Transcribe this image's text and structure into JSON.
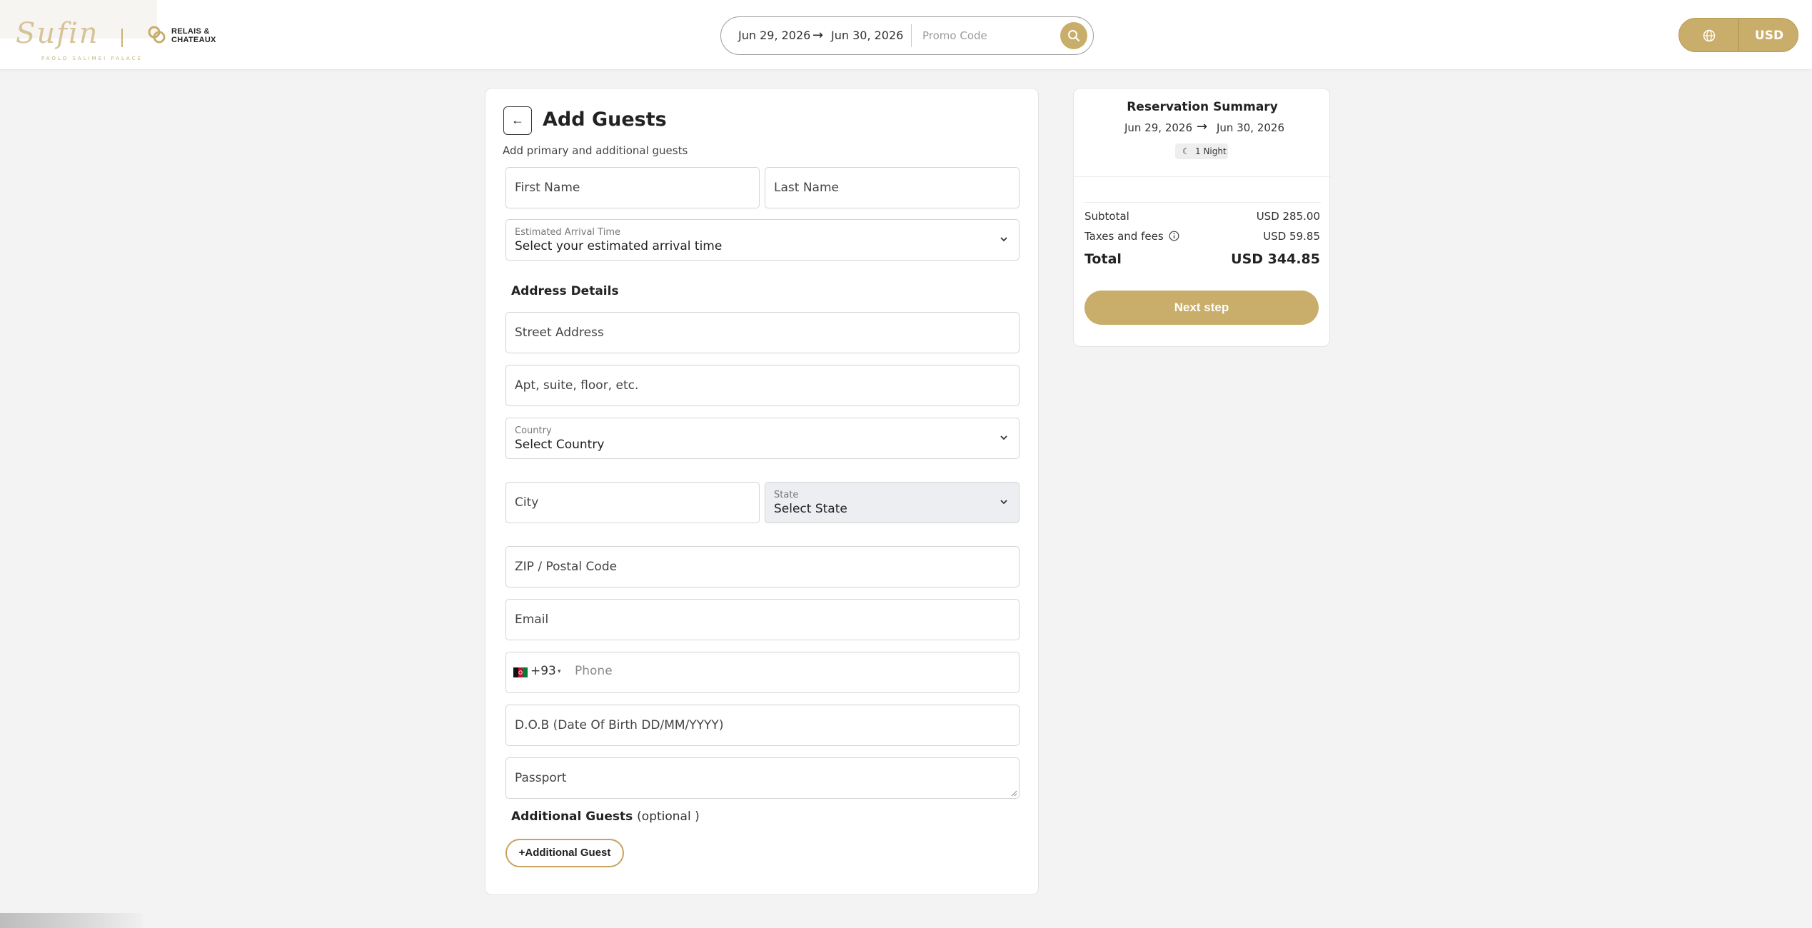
{
  "header": {
    "logo": {
      "script": "Sufin",
      "subtitle": "PAOLO SALIMEI PALACE",
      "partner": "RELAIS &\nCHATEAUX"
    },
    "search": {
      "checkin": "Jun 29, 2026",
      "arrow": "→",
      "checkout": "Jun 30, 2026",
      "promo_placeholder": "Promo Code"
    },
    "currency": "USD"
  },
  "form": {
    "back_label": "←",
    "title": "Add Guests",
    "subtitle": "Add primary and additional guests",
    "first_name": "First Name",
    "last_name": "Last Name",
    "arrival": {
      "label": "Estimated Arrival Time",
      "value": "Select your estimated arrival time"
    },
    "address_heading": "Address Details",
    "street": "Street Address",
    "apt": "Apt, suite, floor, etc.",
    "country": {
      "label": "Country",
      "value": "Select Country"
    },
    "city": "City",
    "state": {
      "label": "State",
      "value": "Select State"
    },
    "zip": "ZIP / Postal Code",
    "email": "Email",
    "phone": {
      "code": "+93",
      "caret": "▾",
      "placeholder": "Phone"
    },
    "dob": "D.O.B (Date Of Birth DD/MM/YYYY)",
    "passport": "Passport",
    "additional_heading": "Additional Guests",
    "additional_optional": "(optional )",
    "add_guest_button": "+Additional Guest"
  },
  "summary": {
    "title": "Reservation Summary",
    "checkin": "Jun 29, 2026",
    "arrow": "→",
    "checkout": "Jun 30, 2026",
    "nights": "1 Night",
    "moon": "☾",
    "subtotal_label": "Subtotal",
    "subtotal_value": "USD 285.00",
    "taxes_label": "Taxes and fees",
    "taxes_value": "USD 59.85",
    "total_label": "Total",
    "total_value": "USD 344.85",
    "next_button": "Next step"
  },
  "colors": {
    "accent": "#c9ae6b",
    "background": "#f3f3f3",
    "border": "#d4d4d4"
  },
  "icons": [
    "search-icon",
    "globe-icon",
    "back-arrow-icon",
    "chevron-down-icon",
    "moon-icon",
    "info-icon",
    "flag-afghanistan-icon"
  ]
}
